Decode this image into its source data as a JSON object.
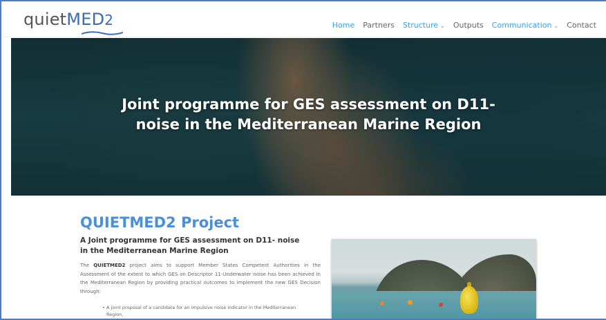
{
  "logo": {
    "part1": "quiet",
    "part2": "MED",
    "part3": "2"
  },
  "nav": {
    "items": [
      {
        "label": "Home",
        "chevron": ""
      },
      {
        "label": "Partners",
        "chevron": ""
      },
      {
        "label": "Structure",
        "chevron": "⌄"
      },
      {
        "label": "Outputs",
        "chevron": ""
      },
      {
        "label": "Communication",
        "chevron": "⌄"
      },
      {
        "label": "Contact",
        "chevron": ""
      }
    ]
  },
  "hero": {
    "title_line1": "Joint programme for GES assessment on D11-",
    "title_line2": "noise in the Mediterranean Marine Region"
  },
  "project": {
    "title": "QUIETMED2 Project",
    "subtitle": "A Joint programme for GES assessment on D11- noise in the Mediterranean Marine Region",
    "body_prefix": "The ",
    "body_bold": "QUIETMED2",
    "body_rest": " project aims to support Member States Competent Authorities in the Assessment of the extent to which GES on Descriptor 11-Underwater noise has been achieved in the Mediterranean Region by providing practical outcomes to implement the new GES Decision through:",
    "bullets": [
      "A joint proposal of a candidate for an impulsive noise indicator in the Mediterranean Region,"
    ]
  },
  "colors": {
    "accent": "#2ea3f2",
    "title_blue": "#4a8fd9",
    "frame_border": "#4a7bd0"
  }
}
